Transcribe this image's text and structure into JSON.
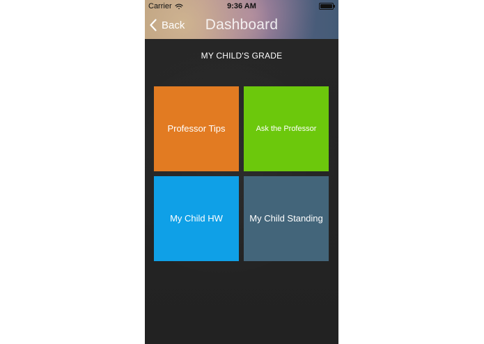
{
  "status_bar": {
    "carrier": "Carrier",
    "time": "9:36 AM",
    "icons": {
      "wifi": "wifi-icon",
      "battery": "battery-icon"
    }
  },
  "nav": {
    "back_label": "Back",
    "title": "Dashboard",
    "icons": {
      "back": "chevron-left-icon"
    }
  },
  "main": {
    "subtitle": "MY CHILD'S GRADE",
    "tiles": [
      {
        "label": "Professor Tips",
        "color": "#E27B22"
      },
      {
        "label": "Ask the Professor",
        "color": "#6CC80C"
      },
      {
        "label": "My Child HW",
        "color": "#0FA0E7"
      },
      {
        "label": "My Child Standing",
        "color": "#43657A"
      }
    ]
  },
  "colors": {
    "background": "#262626",
    "text": "#FFFFFF"
  }
}
